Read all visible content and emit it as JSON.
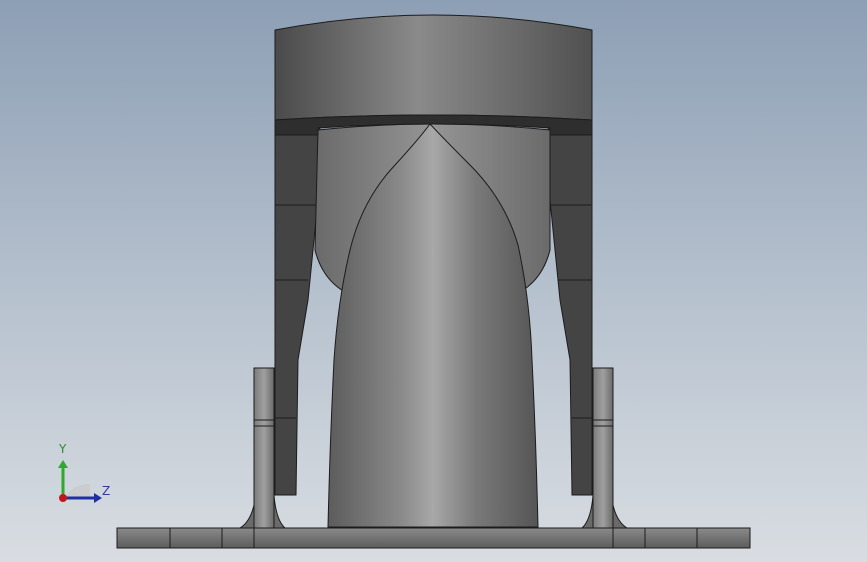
{
  "viewport": {
    "background_top": "#8d9fb5",
    "background_bottom": "#d9dde2"
  },
  "model": {
    "parts": [
      "cylindrical-head",
      "bracket-left",
      "bracket-right",
      "spherical-bowl",
      "nozzle-cone",
      "clevis-left",
      "clevis-right",
      "base-plate"
    ],
    "colors": {
      "light": "#9a9a9a",
      "mid": "#6e6e6e",
      "dark": "#3f3f3f",
      "edge": "#1c1c1c"
    }
  },
  "triad": {
    "y_label": "Y",
    "z_label": "Z",
    "y_color": "#2ea82e",
    "z_color": "#1f2fa8",
    "origin_color": "#c01818"
  }
}
